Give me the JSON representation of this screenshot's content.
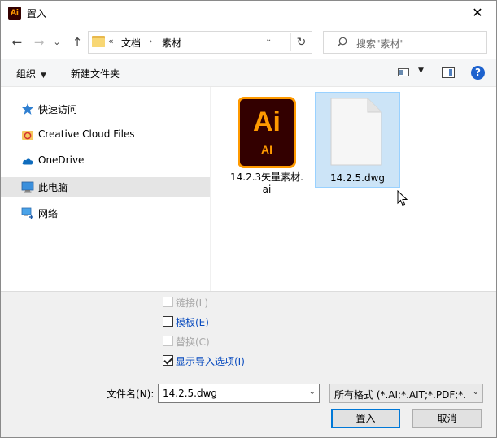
{
  "window": {
    "title": "置入",
    "app_icon_text": "Ai",
    "close_glyph": "✕"
  },
  "nav": {
    "back_glyph": "←",
    "forward_glyph": "→",
    "recent_glyph": "⌄",
    "up_glyph": "↑",
    "overflow_glyph": "«",
    "breadcrumb": [
      "文档",
      "素材"
    ],
    "breadcrumb_sep": "›",
    "dropdown_glyph": "⌄",
    "refresh_glyph": "↻",
    "search_placeholder": "搜索\"素材\""
  },
  "toolbar": {
    "organize_label": "组织",
    "caret_glyph": "▼",
    "new_folder_label": "新建文件夹",
    "help_glyph": "?"
  },
  "sidebar": {
    "items": [
      {
        "label": "快速访问",
        "icon": "star-icon"
      },
      {
        "label": "Creative Cloud Files",
        "icon": "creative-cloud-icon"
      },
      {
        "label": "OneDrive",
        "icon": "cloud-icon"
      },
      {
        "label": "此电脑",
        "icon": "computer-icon",
        "selected": true
      },
      {
        "label": "网络",
        "icon": "network-icon"
      }
    ]
  },
  "files": [
    {
      "name_line1": "14.2.3矢量素材.",
      "name_line2": "ai",
      "icon_big": "Ai",
      "icon_small": "AI",
      "type": "illustrator-file-icon"
    },
    {
      "name": "14.2.5.dwg",
      "type": "document-file-icon",
      "selected": true
    }
  ],
  "options": [
    {
      "label": "链接(L)",
      "checked": false,
      "disabled": true
    },
    {
      "label": "模板(E)",
      "checked": false,
      "disabled": false
    },
    {
      "label": "替换(C)",
      "checked": false,
      "disabled": true
    },
    {
      "label": "显示导入选项(I)",
      "checked": true,
      "disabled": false
    }
  ],
  "filename": {
    "label": "文件名(N):",
    "value": "14.2.5.dwg",
    "caret_glyph": "⌄"
  },
  "filetype": {
    "value": "所有格式 (*.AI;*.AIT;*.PDF;*.DXF;*.DWG)",
    "caret_glyph": "⌄"
  },
  "buttons": {
    "place_label": "置入",
    "cancel_label": "取消"
  },
  "colors": {
    "accent": "#0078d7",
    "selection": "#cce4f7",
    "ai_orange": "#ff9a00",
    "ai_dark": "#330000"
  }
}
